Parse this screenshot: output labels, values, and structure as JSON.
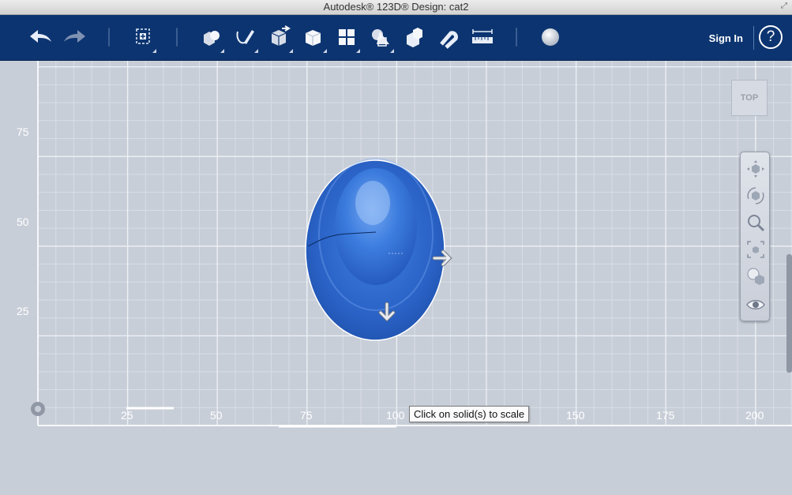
{
  "window": {
    "title": "Autodesk® 123D® Design: cat2"
  },
  "toolbar": {
    "items": [
      {
        "name": "undo-icon"
      },
      {
        "name": "redo-icon"
      },
      {
        "name": "transform-icon"
      },
      {
        "name": "primitives-icon"
      },
      {
        "name": "sketch-icon"
      },
      {
        "name": "construct-icon"
      },
      {
        "name": "modify-icon"
      },
      {
        "name": "pattern-icon"
      },
      {
        "name": "grouping-icon"
      },
      {
        "name": "combine-icon"
      },
      {
        "name": "snap-icon"
      },
      {
        "name": "measure-icon"
      },
      {
        "name": "material-icon"
      }
    ],
    "signin_label": "Sign In",
    "help_label": "?"
  },
  "viewport": {
    "y_axis_labels": [
      "75",
      "50",
      "25"
    ],
    "x_axis_labels": [
      "25",
      "50",
      "75",
      "100",
      "150",
      "175",
      "200"
    ],
    "viewcube_label": "TOP",
    "tooltip": "Click on solid(s) to scale",
    "object": {
      "name": "cat2",
      "color": "#2e6ad0"
    }
  },
  "nav_bar": {
    "items": [
      "pan-icon",
      "orbit-icon",
      "zoom-icon",
      "fit-icon",
      "visual-style-icon",
      "visibility-icon"
    ]
  },
  "colors": {
    "toolbar_bg": "#0c3470",
    "viewport_bg": "#c8ced8",
    "solid": "#2e6ad0"
  }
}
